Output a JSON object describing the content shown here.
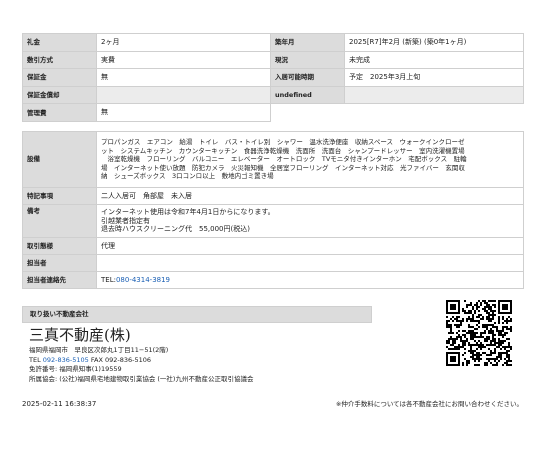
{
  "top_table": [
    {
      "l1": "礼金",
      "v1": "2ヶ月",
      "l2": "築年月",
      "v2": "2025[R7]年2月 (新築) (築0年1ヶ月)"
    },
    {
      "l1": "敷引方式",
      "v1": "実費",
      "l2": "現況",
      "v2": "未完成"
    },
    {
      "l1": "保証金",
      "v1": "無",
      "l2": "入居可能時期",
      "v2": "予定　2025年3月上旬"
    },
    {
      "l1": "保証金償却",
      "v1": "",
      "l2": "undefined",
      "v2": ""
    },
    {
      "l1": "管理費",
      "v1": "無"
    }
  ],
  "details": {
    "equipment_label": "設備",
    "equipment_lines": [
      "プロパンガス　エアコン　給湯　トイレ　バス・トイレ別　シャワー　温水洗浄便座　収納スペース　ウォークインクローゼ",
      "ット　システムキッチン　カウンターキッチン　食器洗浄乾燥機　洗面所　洗面台　シャンプードレッサー　室内洗濯機置場",
      "　浴室乾燥機　フローリング　バルコニー　エレベーター　オートロック　TVモニタ付きインターホン　宅配ボックス　駐輪",
      "場　インターネット使い放題　防犯カメラ　火災報知機　全居室フローリング　インターネット対応　光ファイバー　玄関収",
      "納　シューズボックス　3口コンロ以上　敷地内ゴミ置き場"
    ],
    "special_label": "特記事項",
    "special_value": "二人入居可　角部屋　未入居",
    "remarks_label": "備考",
    "remarks_lines": [
      "インターネット使用は令和7年4月1日からになります。",
      "引越業者指定有",
      "退去時ハウスクリーニング代　55,000円(税込)"
    ],
    "transaction_label": "取引態様",
    "transaction_value": "代理",
    "staff_label": "担当者",
    "staff_value": "",
    "contact_label": "担当者連絡先",
    "contact_prefix": "TEL:",
    "contact_tel": "080-4314-3819"
  },
  "company": {
    "header": "取り扱い不動産会社",
    "name": "三真不動産(株)",
    "address": "福岡県福岡市　早良区次郎丸1丁目11−51(2階)",
    "tel_prefix": "TEL ",
    "tel": "092-836-5105",
    "fax": " FAX 092-836-5106",
    "license": "免許番号: 福岡県知事(1)19559",
    "association": "所属協会: (公社)福岡県宅地建物取引業協会 (一社)九州不動産公正取引協議会"
  },
  "footer": {
    "timestamp": "2025-02-11 16:38:37",
    "note": "※仲介手数料については各不動産会社にお問い合わせください。"
  },
  "colors": {
    "label_bg": "#dcdcdc",
    "border": "#cfcfcf",
    "link": "#1a5fb4"
  }
}
